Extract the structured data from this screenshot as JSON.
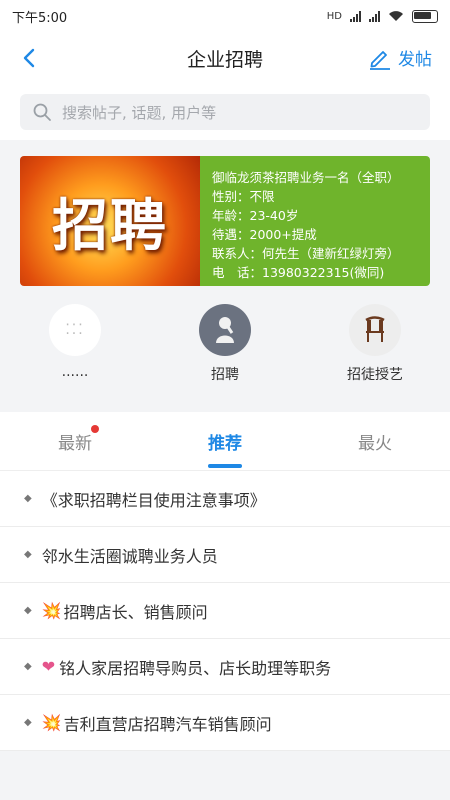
{
  "status": {
    "time": "下午5:00",
    "net": "HD"
  },
  "nav": {
    "title": "企业招聘",
    "post_label": "发帖"
  },
  "search": {
    "placeholder": "搜索帖子, 话题, 用户等"
  },
  "banner": {
    "big_text": "招聘",
    "lines": [
      "御临龙须茶招聘业务一名（全职）",
      "性别：不限",
      "年龄：23-40岁",
      "待遇：2000+提成",
      "联系人：何先生（建新红绿灯旁）",
      "电　话：13980322315(微同)"
    ]
  },
  "shortcuts": [
    {
      "label": "......",
      "icon": "more-icon"
    },
    {
      "label": "招聘",
      "icon": "person-thinking-icon"
    },
    {
      "label": "招徒授艺",
      "icon": "chair-icon"
    }
  ],
  "tabs": [
    "最新",
    "推荐",
    "最火"
  ],
  "active_tab": "推荐",
  "posts": [
    {
      "emoji": "",
      "title": "《求职招聘栏目使用注意事项》"
    },
    {
      "emoji": "",
      "title": "邻水生活圈诚聘业务人员"
    },
    {
      "emoji": "💥",
      "title": "招聘店长、销售顾问"
    },
    {
      "emoji": "❤",
      "title": "铭人家居招聘导购员、店长助理等职务"
    },
    {
      "emoji": "💥",
      "title": "吉利直营店招聘汽车销售顾问"
    }
  ],
  "colors": {
    "accent": "#1e88e5",
    "badge": "#e53935",
    "banner_green": "#6fb42c"
  }
}
